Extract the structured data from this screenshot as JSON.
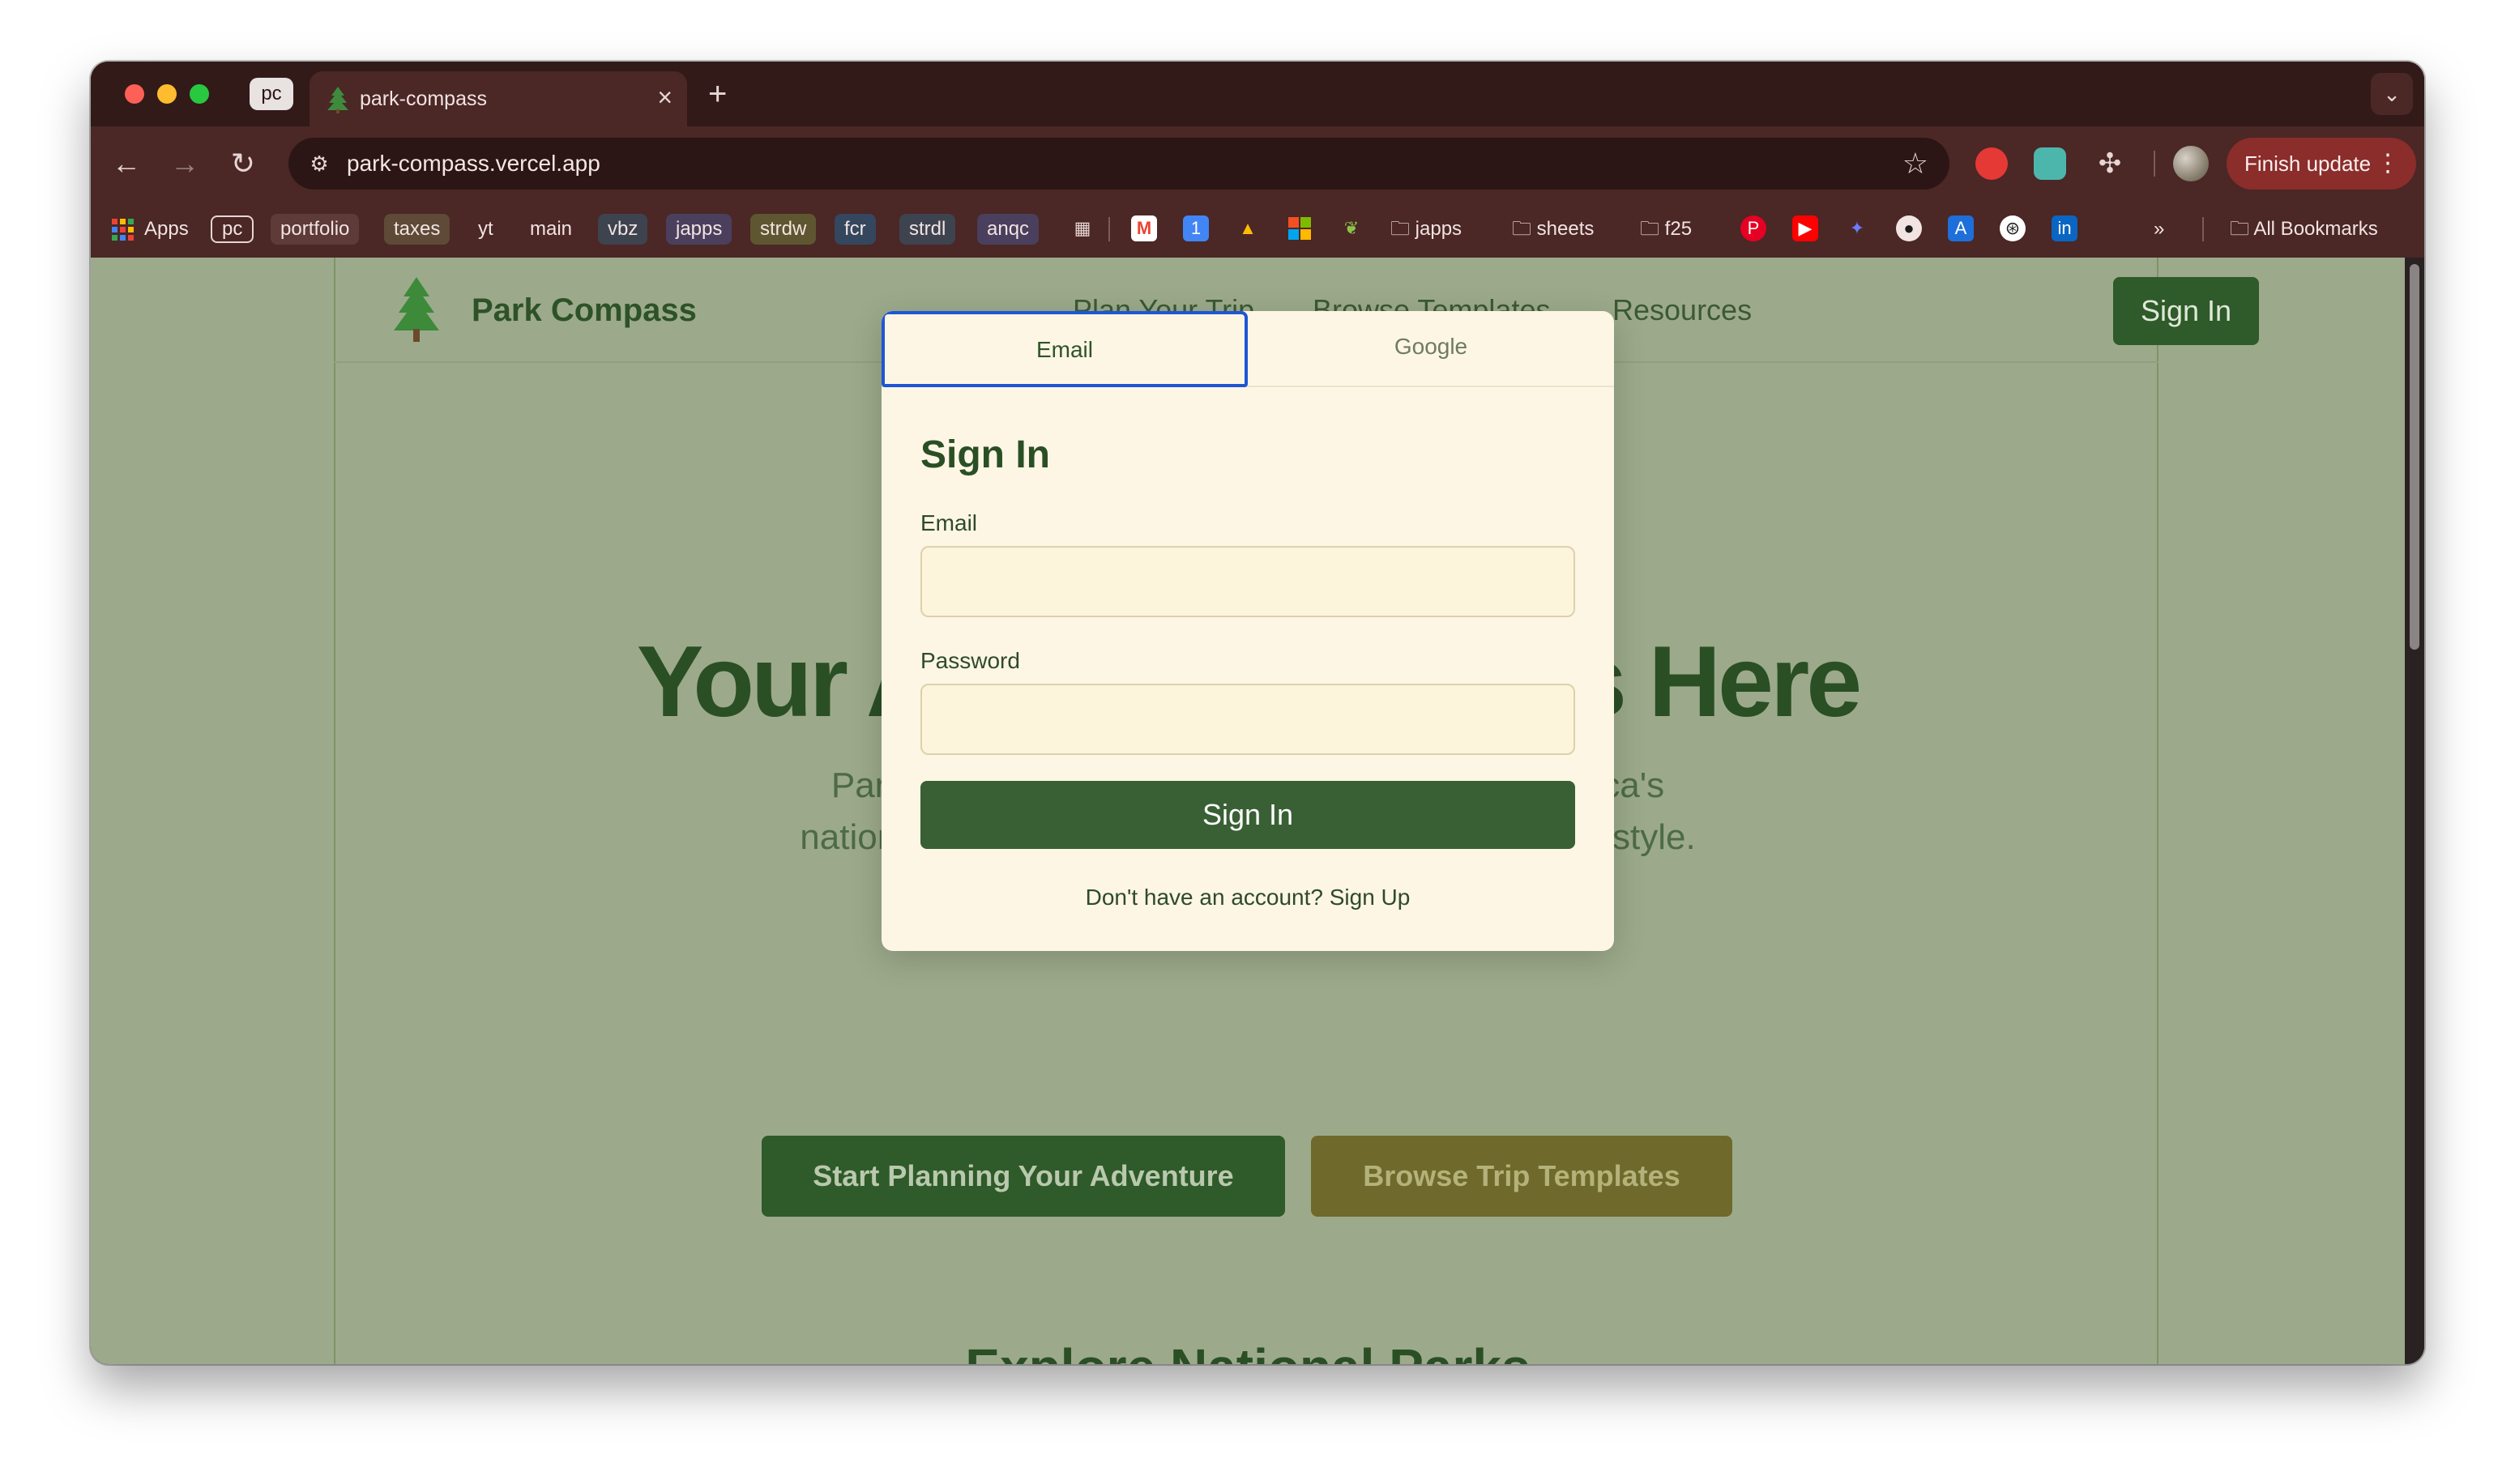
{
  "browser": {
    "pinned_tab_label": "pc",
    "active_tab_title": "park-compass",
    "new_tab_symbol": "+",
    "url": "park-compass.vercel.app",
    "update_label": "Finish update",
    "bookmarks": [
      {
        "label": "Apps"
      },
      {
        "label": "pc"
      },
      {
        "label": "portfolio"
      },
      {
        "label": "taxes"
      },
      {
        "label": "yt"
      },
      {
        "label": "main"
      },
      {
        "label": "vbz"
      },
      {
        "label": "japps"
      },
      {
        "label": "strdw"
      },
      {
        "label": "fcr"
      },
      {
        "label": "strdl"
      },
      {
        "label": "anqc"
      }
    ],
    "bookmark_folders": [
      {
        "label": "japps"
      },
      {
        "label": "sheets"
      },
      {
        "label": "f25"
      }
    ],
    "all_bookmarks_label": "All Bookmarks",
    "overflow_symbol": "»"
  },
  "site": {
    "logo_text": "Park Compass",
    "nav": [
      "Plan Your Trip",
      "Browse Templates",
      "Resources"
    ],
    "header_signin_label": "Sign In",
    "hero_title": "Your Adventure Starts Here",
    "hero_subtitle_line1": "Park Compass helps you plan and explore America's",
    "hero_subtitle_line2": "national parks with itineraries tailored to your travel style.",
    "cta_primary": "Start Planning Your Adventure",
    "cta_secondary": "Browse Trip Templates",
    "explore_heading": "Explore National Parks"
  },
  "modal": {
    "tabs": [
      "Email",
      "Google"
    ],
    "active_tab": "Email",
    "title": "Sign In",
    "email_label": "Email",
    "email_value": "",
    "password_label": "Password",
    "password_value": "",
    "submit_label": "Sign In",
    "footer_text": "Don't have an account? Sign Up"
  },
  "colors": {
    "page_background": "#9caa8b",
    "primary_green": "#2f5a2a",
    "modal_background": "#fdf6e4",
    "active_tab_border": "#1f56d6",
    "secondary_button": "#6f6a2b"
  }
}
